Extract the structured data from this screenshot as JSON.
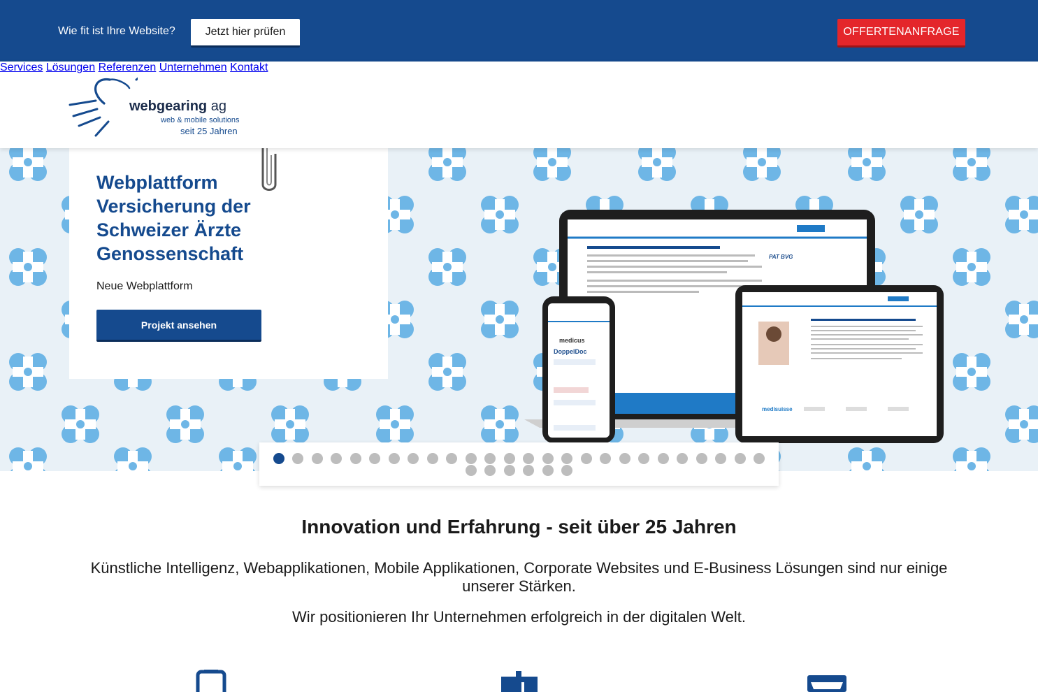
{
  "topbar": {
    "question": "Wie fit ist Ihre Website?",
    "check_label": "Jetzt hier prüfen",
    "offer_label": "OFFERTENANFRAGE"
  },
  "logo": {
    "brand": "webgearing",
    "brand_suffix": "ag",
    "tagline1": "web & mobile solutions",
    "tagline2": "seit 25 Jahren"
  },
  "nav": {
    "items": [
      {
        "label": "Services"
      },
      {
        "label": "Lösungen"
      },
      {
        "label": "Referenzen"
      },
      {
        "label": "Unternehmen"
      },
      {
        "label": "Kontakt"
      }
    ]
  },
  "hero": {
    "title": "Webplattform Versicherung der Schweizer Ärzte Genossenschaft",
    "subtitle": "Neue Webplattform",
    "button_label": "Projekt ansehen"
  },
  "slider": {
    "count": 32,
    "active_index": 0
  },
  "intro": {
    "heading": "Innovation und Erfahrung - seit über 25 Jahren",
    "paragraph1": "Künstliche Intelligenz, Webapplikationen, Mobile Applikationen, Corporate Websites und E-Business Lösungen sind nur einige unserer Stärken.",
    "paragraph2": "Wir positionieren Ihr Unternehmen erfolgreich in der digitalen Welt."
  },
  "colors": {
    "brand_blue": "#154a8e",
    "accent_red": "#e4262b",
    "pattern_blue": "#6eb6e6"
  },
  "icons": [
    "mobile-icon",
    "chart-icon",
    "shop-icon"
  ]
}
